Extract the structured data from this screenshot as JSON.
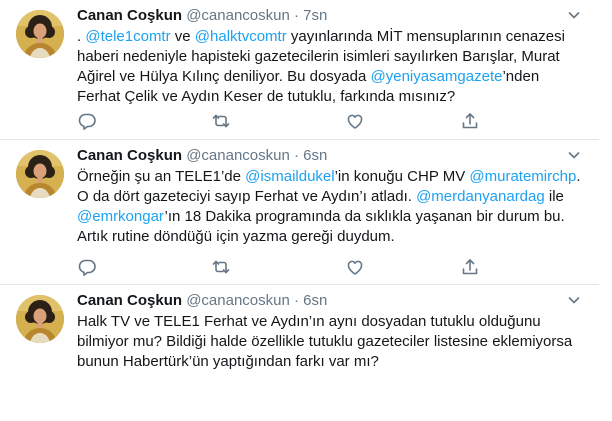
{
  "tweets": [
    {
      "name": "Canan Coşkun",
      "handle": "@canancoskun",
      "sep": "·",
      "time": "7sn",
      "segments": [
        {
          "t": ". ",
          "m": false
        },
        {
          "t": "@tele1comtr",
          "m": true
        },
        {
          "t": " ve ",
          "m": false
        },
        {
          "t": "@halktvcomtr",
          "m": true
        },
        {
          "t": " yayınlarında MİT mensuplarının cenazesi haberi nedeniyle hapisteki gazetecilerin isimleri sayılırken Barışlar, Murat Ağirel ve Hülya Kılınç deniliyor. Bu dosyada ",
          "m": false
        },
        {
          "t": "@yeniyasamgazete",
          "m": true
        },
        {
          "t": "’nden Ferhat Çelik ve Aydın Keser de tutuklu, farkında mısınız?",
          "m": false
        }
      ]
    },
    {
      "name": "Canan Coşkun",
      "handle": "@canancoskun",
      "sep": "·",
      "time": "6sn",
      "segments": [
        {
          "t": "Örneğin şu an TELE1’de ",
          "m": false
        },
        {
          "t": "@ismaildukel",
          "m": true
        },
        {
          "t": "’in konuğu CHP MV ",
          "m": false
        },
        {
          "t": "@muratemirchp",
          "m": true
        },
        {
          "t": ". O da dört gazeteciyi sayıp Ferhat ve Aydın’ı atladı. ",
          "m": false
        },
        {
          "t": "@merdanyanardag",
          "m": true
        },
        {
          "t": " ile ",
          "m": false
        },
        {
          "t": "@emrkongar",
          "m": true
        },
        {
          "t": "’ın 18 Dakika programında da sıklıkla yaşanan bir durum bu. Artık rutine döndüğü için yazma gereği duydum.",
          "m": false
        }
      ]
    },
    {
      "name": "Canan Coşkun",
      "handle": "@canancoskun",
      "sep": "·",
      "time": "6sn",
      "segments": [
        {
          "t": "Halk TV ve TELE1 Ferhat ve Aydın’ın aynı dosyadan tutuklu olduğunu bilmiyor mu? Bildiği halde özellikle tutuklu gazeteciler listesine eklemiyorsa bunun Habertürk’ün yaptığından farkı var mı?",
          "m": false
        }
      ]
    }
  ],
  "icons": [
    "reply-icon",
    "retweet-icon",
    "like-icon",
    "share-icon",
    "chevron-down-icon"
  ],
  "colors": {
    "text": "#14171a",
    "secondary": "#657786",
    "link": "#1da1f2",
    "divider": "#e1e8ed"
  }
}
